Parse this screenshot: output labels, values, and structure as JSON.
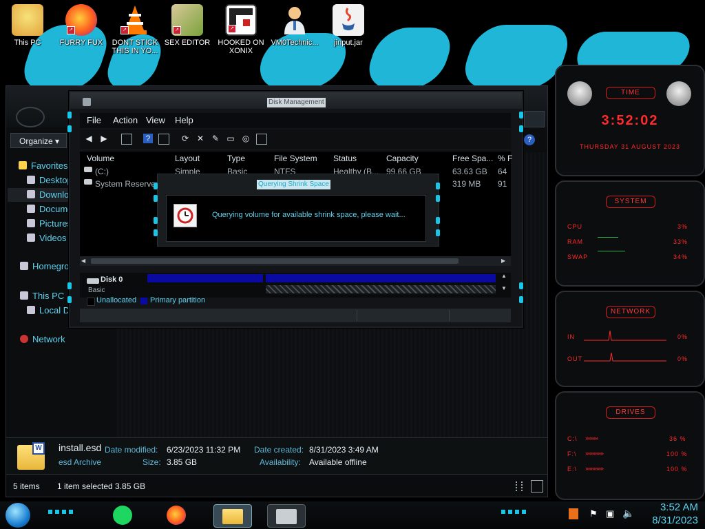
{
  "colors": {
    "accent_cyan": "#19c6e8",
    "accent_red": "#ff2a2a",
    "partition_blue": "#0a0aa0"
  },
  "desktop_icons": [
    {
      "label": "This PC",
      "icon": "pc-icon"
    },
    {
      "label": "FURRY FUX",
      "icon": "firefox-icon"
    },
    {
      "label": "DONT STICK THIS IN YO...",
      "icon": "vlc-cone-icon"
    },
    {
      "label": "SEX EDITOR",
      "icon": "hxd-editor-icon"
    },
    {
      "label": "HOOKED ON XONIX",
      "icon": "xonix-game-icon"
    },
    {
      "label": "VM0Technic...",
      "icon": "technician-icon"
    },
    {
      "label": "jinput.jar",
      "icon": "java-jar-icon"
    }
  ],
  "explorer": {
    "organize_label": "Organize",
    "nav": [
      {
        "label": "Favorites"
      },
      {
        "label": "Desktop"
      },
      {
        "label": "Downloads"
      },
      {
        "label": "Documents"
      },
      {
        "label": "Pictures"
      },
      {
        "label": "Videos"
      },
      {
        "label": "Homegroup"
      },
      {
        "label": "This PC"
      },
      {
        "label": "Local Disk"
      },
      {
        "label": "Network"
      }
    ],
    "details": {
      "file_name": "install.esd",
      "file_type": "esd Archive",
      "date_modified_label": "Date modified:",
      "date_modified": "6/23/2023 11:32 PM",
      "size_label": "Size:",
      "size": "3.85 GB",
      "date_created_label": "Date created:",
      "date_created": "8/31/2023 3:49 AM",
      "availability_label": "Availability:",
      "availability": "Available offline"
    },
    "status": {
      "items_count": "5 items",
      "selected": "1 item selected  3.85 GB"
    }
  },
  "disk_management": {
    "title": "Disk Management",
    "menu": [
      "File",
      "Action",
      "View",
      "Help"
    ],
    "columns": [
      "Volume",
      "Layout",
      "Type",
      "File System",
      "Status",
      "Capacity",
      "Free Spa...",
      "% F"
    ],
    "rows": [
      {
        "volume": "(C:)",
        "layout": "Simple",
        "type": "Basic",
        "fs": "NTFS",
        "status": "Healthy (B...",
        "capacity": "99.66 GB",
        "free": "63.63 GB",
        "pct": "64"
      },
      {
        "volume": "System Reserved",
        "layout": "",
        "type": "",
        "fs": "",
        "status": "",
        "capacity": "",
        "free": "319 MB",
        "pct": "91"
      }
    ],
    "disk_label": "Disk 0",
    "disk_sub": "Basic",
    "legend": {
      "unallocated": "Unallocated",
      "primary": "Primary partition"
    }
  },
  "query_dialog": {
    "title": "Querying Shrink Space",
    "message": "Querying volume for available shrink space, please wait..."
  },
  "gadgets": {
    "time": {
      "title": "TIME",
      "clock": "3:52:02",
      "date": "THURSDAY 31 AUGUST 2023"
    },
    "system": {
      "title": "SYSTEM",
      "rows": [
        {
          "label": "CPU",
          "value": "3%"
        },
        {
          "label": "RAM",
          "value": "33%"
        },
        {
          "label": "SWAP",
          "value": "34%"
        }
      ]
    },
    "network": {
      "title": "NETWORK",
      "rows": [
        {
          "label": "IN",
          "value": "0%"
        },
        {
          "label": "OUT",
          "value": "0%"
        }
      ]
    },
    "drives": {
      "title": "DRIVES",
      "rows": [
        {
          "label": "C:\\",
          "value": "36 %"
        },
        {
          "label": "F:\\",
          "value": "100 %"
        },
        {
          "label": "E:\\",
          "value": "100 %"
        }
      ]
    }
  },
  "taskbar": {
    "time": "3:52 AM",
    "date": "8/31/2023"
  }
}
